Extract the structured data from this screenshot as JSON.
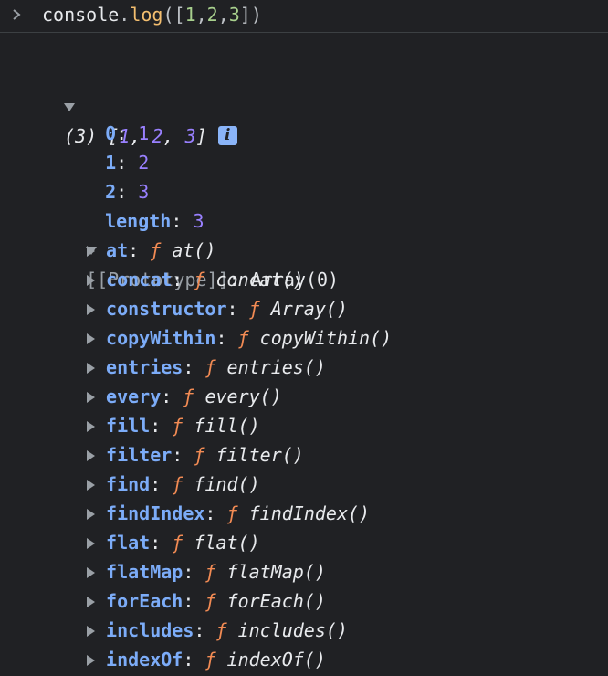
{
  "input": {
    "prompt": ">",
    "text_parts": [
      "console",
      ".",
      "log",
      "(",
      "[",
      "1",
      ",",
      "2",
      ",",
      "3",
      "]",
      ")"
    ]
  },
  "output": {
    "count": "(3)",
    "preview_open": "[",
    "preview_values": [
      "1",
      "2",
      "3"
    ],
    "preview_sep": ", ",
    "preview_close": "]",
    "info": "i",
    "entries": [
      {
        "key": "0",
        "value": "1"
      },
      {
        "key": "1",
        "value": "2"
      },
      {
        "key": "2",
        "value": "3"
      }
    ],
    "length": {
      "key": "length",
      "value": "3"
    },
    "prototype": {
      "key": "[[Prototype]]",
      "value": "Array(0)"
    },
    "methods": [
      {
        "key": "at",
        "fn": "at()"
      },
      {
        "key": "concat",
        "fn": "concat()"
      },
      {
        "key": "constructor",
        "fn": "Array()"
      },
      {
        "key": "copyWithin",
        "fn": "copyWithin()"
      },
      {
        "key": "entries",
        "fn": "entries()"
      },
      {
        "key": "every",
        "fn": "every()"
      },
      {
        "key": "fill",
        "fn": "fill()"
      },
      {
        "key": "filter",
        "fn": "filter()"
      },
      {
        "key": "find",
        "fn": "find()"
      },
      {
        "key": "findIndex",
        "fn": "findIndex()"
      },
      {
        "key": "flat",
        "fn": "flat()"
      },
      {
        "key": "flatMap",
        "fn": "flatMap()"
      },
      {
        "key": "forEach",
        "fn": "forEach()"
      },
      {
        "key": "includes",
        "fn": "includes()"
      },
      {
        "key": "indexOf",
        "fn": "indexOf()"
      }
    ],
    "function_symbol": "ƒ"
  },
  "colors": {
    "background": "#202124",
    "property_key": "#7cacf8",
    "number": "#9980ff",
    "function_symbol": "#f28b54",
    "method_name": "#f3be6f",
    "info_badge": "#8ab4f8"
  }
}
